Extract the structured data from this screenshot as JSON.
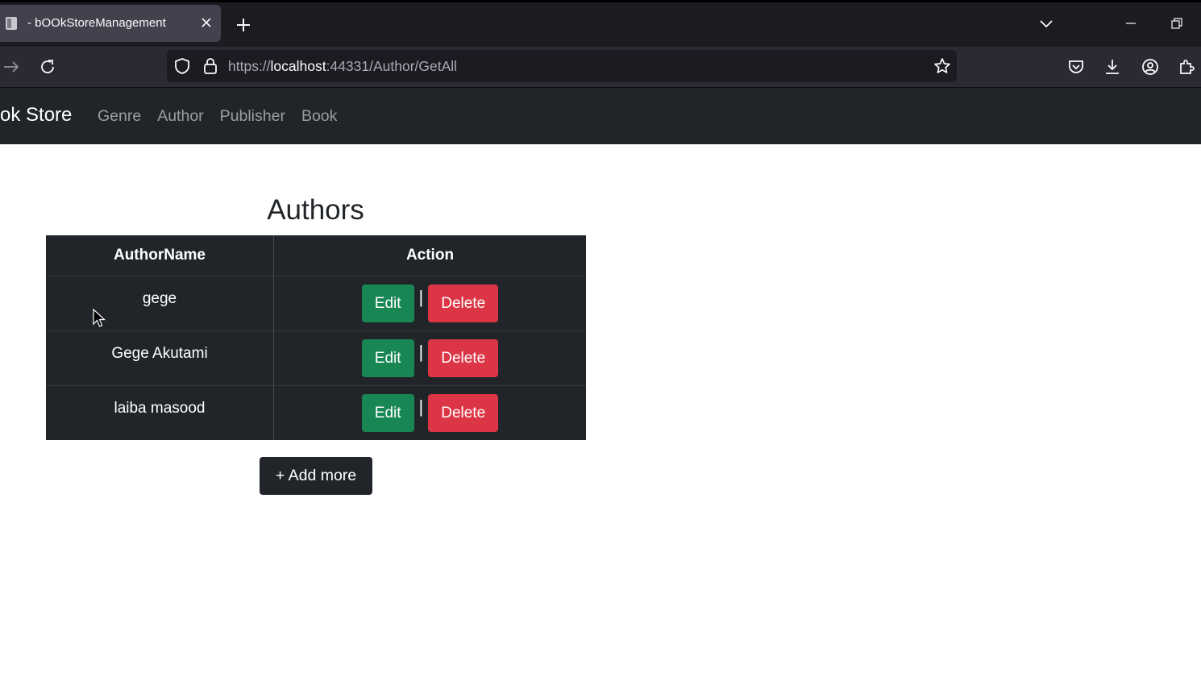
{
  "browser": {
    "tab_title": "- bOOkStoreManagement",
    "url_prefix": "https://",
    "url_host": "localhost",
    "url_rest": ":44331/Author/GetAll"
  },
  "site": {
    "brand": "ok Store",
    "nav": [
      "Genre",
      "Author",
      "Publisher",
      "Book"
    ]
  },
  "page": {
    "title": "Authors",
    "columns": [
      "AuthorName",
      "Action"
    ],
    "rows": [
      {
        "name": "gege",
        "edit": "Edit",
        "separator": "|",
        "delete": "Delete"
      },
      {
        "name": "Gege Akutami",
        "edit": "Edit",
        "separator": "|",
        "delete": "Delete"
      },
      {
        "name": "laiba masood",
        "edit": "Edit",
        "separator": "|",
        "delete": "Delete"
      }
    ],
    "add_more": "+ Add more"
  },
  "colors": {
    "navbar": "#212529",
    "edit": "#198754",
    "delete": "#dc3545"
  }
}
